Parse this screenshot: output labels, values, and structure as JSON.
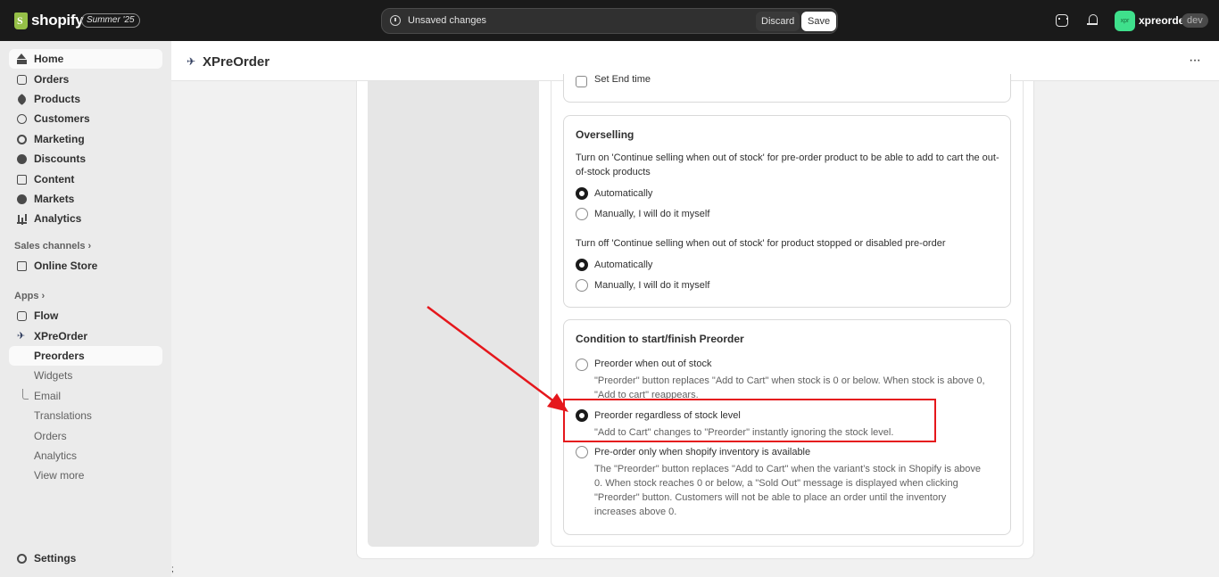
{
  "topbar": {
    "logo_text": "shopify",
    "edition": "Summer '25",
    "unsaved_text": "Unsaved changes",
    "discard_label": "Discard",
    "save_label": "Save",
    "avatar_text": "xpr",
    "store_name": "xpreorder",
    "dev_badge": "dev"
  },
  "sidebar": {
    "main_items": [
      {
        "label": "Home",
        "icon": "home-icon"
      },
      {
        "label": "Orders",
        "icon": "orders-icon"
      },
      {
        "label": "Products",
        "icon": "tag-icon"
      },
      {
        "label": "Customers",
        "icon": "person-icon"
      },
      {
        "label": "Marketing",
        "icon": "target-icon"
      },
      {
        "label": "Discounts",
        "icon": "discount-icon"
      },
      {
        "label": "Content",
        "icon": "content-icon"
      },
      {
        "label": "Markets",
        "icon": "globe-icon"
      },
      {
        "label": "Analytics",
        "icon": "bar-chart-icon"
      }
    ],
    "sales_channels_heading": "Sales channels",
    "online_store": "Online Store",
    "apps_heading": "Apps",
    "flow": "Flow",
    "xpreorder": "XPreOrder",
    "sub_items": [
      "Preorders",
      "Widgets",
      "Email",
      "Translations",
      "Orders",
      "Analytics",
      "View more"
    ],
    "settings": "Settings"
  },
  "app": {
    "title": "XPreOrder",
    "more": "···"
  },
  "form": {
    "end_time_label": "Set End time",
    "overselling": {
      "title": "Overselling",
      "desc_on": "Turn on 'Continue selling when out of stock' for pre-order product to be able to add to cart the out-of-stock products",
      "on_options": [
        "Automatically",
        "Manually, I will do it myself"
      ],
      "on_selected": "Automatically",
      "desc_off": "Turn off 'Continue selling when out of stock' for product stopped or disabled pre-order",
      "off_options": [
        "Automatically",
        "Manually, I will do it myself"
      ],
      "off_selected": "Automatically"
    },
    "condition": {
      "title": "Condition to start/finish Preorder",
      "options": [
        {
          "label": "Preorder when out of stock",
          "help": "\"Preorder\" button replaces \"Add to Cart\" when stock is 0 or below. When stock is above 0, \"Add to cart\" reappears."
        },
        {
          "label": "Preorder regardless of stock level",
          "help": "\"Add to Cart\" changes to \"Preorder\" instantly ignoring the stock level."
        },
        {
          "label": "Pre-order only when shopify inventory is available",
          "help": "The \"Preorder\" button replaces \"Add to Cart\" when the variant’s stock in Shopify is above 0. When stock reaches 0 or below, a \"Sold Out\" message is displayed when clicking \"Preorder\" button. Customers will not be able to place an order until the inventory increases above 0."
        }
      ],
      "selected": "Preorder regardless of stock level"
    }
  },
  "annotation_color": "#e5171c",
  "bottom_char": ";"
}
